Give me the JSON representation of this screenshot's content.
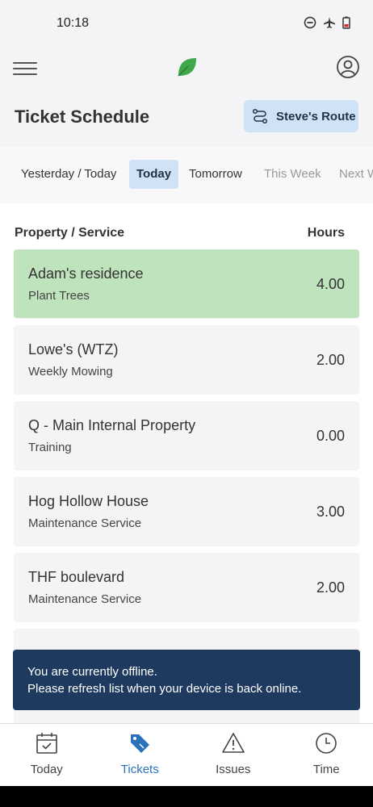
{
  "status_bar": {
    "time": "10:18",
    "icons": [
      "dnd-icon",
      "airplane-icon",
      "battery-icon"
    ]
  },
  "app_bar": {
    "menu_icon": "hamburger-icon",
    "logo_icon": "leaf-logo",
    "profile_icon": "account-icon"
  },
  "header": {
    "title": "Ticket Schedule",
    "route_button": {
      "label": "Steve's Route",
      "icon": "route-icon"
    }
  },
  "date_tabs": [
    {
      "label": "Yesterday / Today",
      "active": false
    },
    {
      "label": "Today",
      "active": true
    },
    {
      "label": "Tomorrow",
      "active": false
    },
    {
      "label": "This Week",
      "active": false
    },
    {
      "label": "Next W",
      "active": false
    }
  ],
  "columns": {
    "property": "Property / Service",
    "hours": "Hours"
  },
  "tickets": [
    {
      "property": "Adam's residence",
      "service": "Plant Trees",
      "hours": "4.00",
      "selected": true
    },
    {
      "property": "Lowe's (WTZ)",
      "service": "Weekly Mowing",
      "hours": "2.00",
      "selected": false
    },
    {
      "property": "Q - Main Internal Property",
      "service": "Training",
      "hours": "0.00",
      "selected": false
    },
    {
      "property": "Hog Hollow House",
      "service": "Maintenance Service",
      "hours": "3.00",
      "selected": false
    },
    {
      "property": "THF boulevard",
      "service": "Maintenance Service",
      "hours": "2.00",
      "selected": false
    }
  ],
  "toast": {
    "line1": "You are currently offline.",
    "line2": "Please refresh list when your device is back online."
  },
  "bottom_nav": [
    {
      "label": "Today",
      "icon": "calendar-icon",
      "active": false
    },
    {
      "label": "Tickets",
      "icon": "tag-icon",
      "active": true
    },
    {
      "label": "Issues",
      "icon": "warning-icon",
      "active": false
    },
    {
      "label": "Time",
      "icon": "clock-icon",
      "active": false
    }
  ],
  "colors": {
    "accent_blue": "#2a73b8",
    "selected_green": "#bfe3bd",
    "toast_bg": "#1f3a5f",
    "tab_active_bg": "#cfe2f6",
    "logo_green": "#3ea84a"
  }
}
